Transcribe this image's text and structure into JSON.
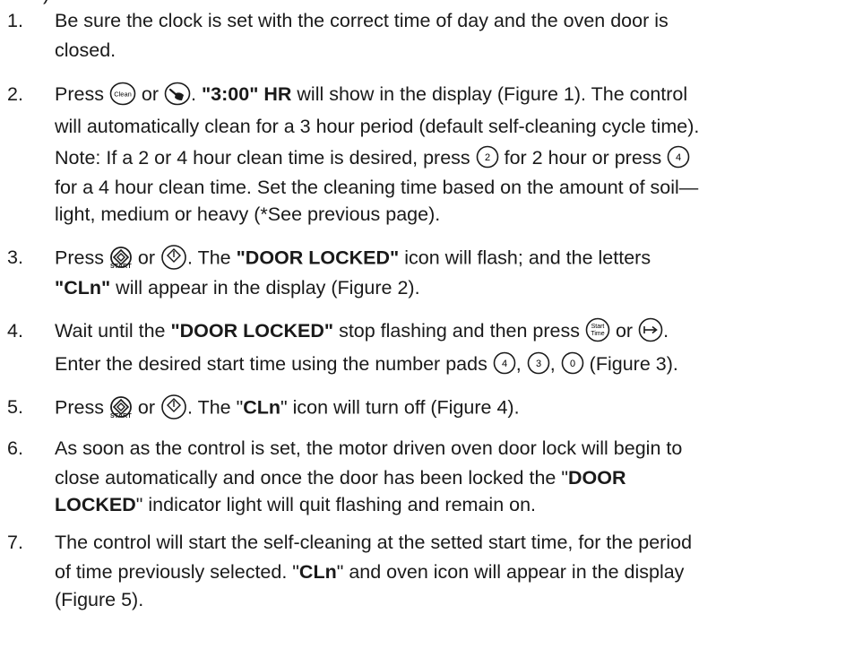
{
  "header_cut": ")",
  "steps": [
    {
      "num": "1.",
      "lines": [
        [
          "Be sure the clock is set with the correct time of day and the oven door is"
        ],
        [
          "closed."
        ]
      ]
    },
    {
      "num": "2.",
      "lines": [
        [
          "Press ",
          {
            "icon": "clean"
          },
          " or ",
          {
            "icon": "brush"
          },
          ". ",
          {
            "b": "\"3:00\" HR"
          },
          " will show in the display (Figure 1). The control"
        ],
        [
          "will automatically clean for a 3 hour period (default self-cleaning cycle time)."
        ],
        [
          "Note: If a 2 or 4 hour clean time is desired, press ",
          {
            "icon": "num",
            "t": "2"
          },
          " for 2 hour or press ",
          {
            "icon": "num",
            "t": "4"
          }
        ],
        [
          "for a 4 hour clean time. Set the cleaning time based on the amount of soil—"
        ],
        [
          "light, medium or heavy (*See previous page)."
        ]
      ]
    },
    {
      "num": "3.",
      "lines": [
        [
          "Press ",
          {
            "icon": "start"
          },
          " or ",
          {
            "icon": "power"
          },
          ". The ",
          {
            "b": "\"DOOR LOCKED\""
          },
          " icon will flash; and the letters"
        ],
        [
          {
            "b": "\"CLn\""
          },
          " will appear in the display (Figure 2)."
        ]
      ]
    },
    {
      "num": "4.",
      "lines": [
        [
          "Wait until the ",
          {
            "b": "\"DOOR LOCKED\""
          },
          " stop flashing and then press ",
          {
            "icon": "starttime"
          },
          " or ",
          {
            "icon": "arrow"
          },
          "."
        ],
        [
          "Enter the desired start time using the number pads ",
          {
            "icon": "num",
            "t": "4"
          },
          ", ",
          {
            "icon": "num",
            "t": "3"
          },
          ", ",
          {
            "icon": "num",
            "t": "0"
          },
          " (Figure 3)."
        ]
      ]
    },
    {
      "num": "5.",
      "lines": [
        [
          "Press ",
          {
            "icon": "start"
          },
          " or ",
          {
            "icon": "power"
          },
          ". The \"",
          {
            "b": "CLn"
          },
          "\" icon will turn off (Figure 4)."
        ]
      ]
    },
    {
      "num": "6.",
      "lines": [
        [
          "As soon as the control is set, the motor driven oven door lock will begin to"
        ],
        [
          "close automatically and once the door has been locked the \"",
          {
            "b": "DOOR"
          }
        ],
        [
          {
            "b": "LOCKED"
          },
          "\" indicator light will quit flashing and remain on."
        ]
      ]
    },
    {
      "num": "7.",
      "lines": [
        [
          "The control will start the self-cleaning at the setted start time, for the period"
        ],
        [
          "of time previously selected. \"",
          {
            "b": "CLn"
          },
          "\" and oven icon will appear in the display"
        ],
        [
          "(Figure 5)."
        ]
      ]
    }
  ],
  "icon_text": {
    "clean": "Clean",
    "start_label": "START",
    "starttime_top": "Start",
    "starttime_bottom": "Time"
  }
}
